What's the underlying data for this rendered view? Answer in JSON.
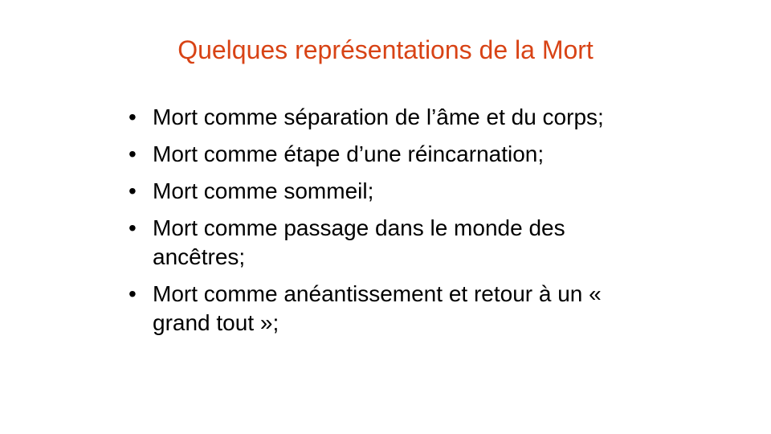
{
  "slide": {
    "title": "Quelques représentations de la Mort",
    "title_color": "#d84315",
    "bullet_glyph": "•",
    "items": [
      "Mort comme séparation de l’âme et du corps;",
      "Mort comme étape d’une réincarnation;",
      "Mort comme sommeil;",
      "Mort comme passage dans le monde des ancêtres;",
      "Mort comme anéantissement et retour à un « grand tout »;"
    ]
  }
}
